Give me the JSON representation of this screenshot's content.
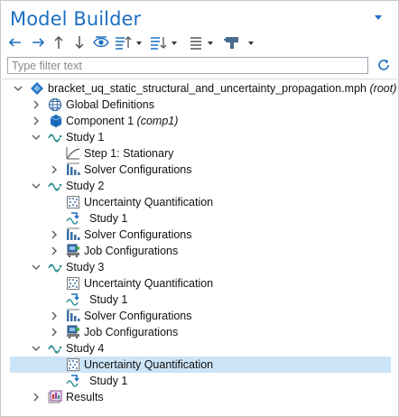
{
  "panel": {
    "title": "Model Builder",
    "filter_placeholder": "Type filter text"
  },
  "toolbar": {
    "icons": [
      "back-arrow-icon",
      "forward-arrow-icon",
      "move-up-icon",
      "move-down-icon",
      "show-icon",
      "collapse-menu-icon",
      "expand-menu-icon",
      "view-menu-icon",
      "build-menu-icon"
    ]
  },
  "tree": {
    "root": {
      "label": "bracket_uq_static_structural_and_uncertainty_propagation.mph",
      "tag": "(root)"
    },
    "global_definitions": {
      "label": "Global Definitions"
    },
    "component1": {
      "label": "Component 1",
      "tag": "(comp1)"
    },
    "study1": {
      "label": "Study 1",
      "step1": "Step 1: Stationary",
      "solver": "Solver Configurations"
    },
    "study2": {
      "label": "Study 2",
      "uq": "Uncertainty Quantification",
      "ref": "Study 1",
      "solver": "Solver Configurations",
      "job": "Job Configurations"
    },
    "study3": {
      "label": "Study 3",
      "uq": "Uncertainty Quantification",
      "ref": "Study 1",
      "solver": "Solver Configurations",
      "job": "Job Configurations"
    },
    "study4": {
      "label": "Study 4",
      "uq": "Uncertainty Quantification",
      "ref": "Study 1"
    },
    "results": {
      "label": "Results"
    }
  },
  "colors": {
    "title": "#1c6fc0",
    "selected_row": "#cce4f7",
    "study_icon": "#2a8f8f"
  }
}
